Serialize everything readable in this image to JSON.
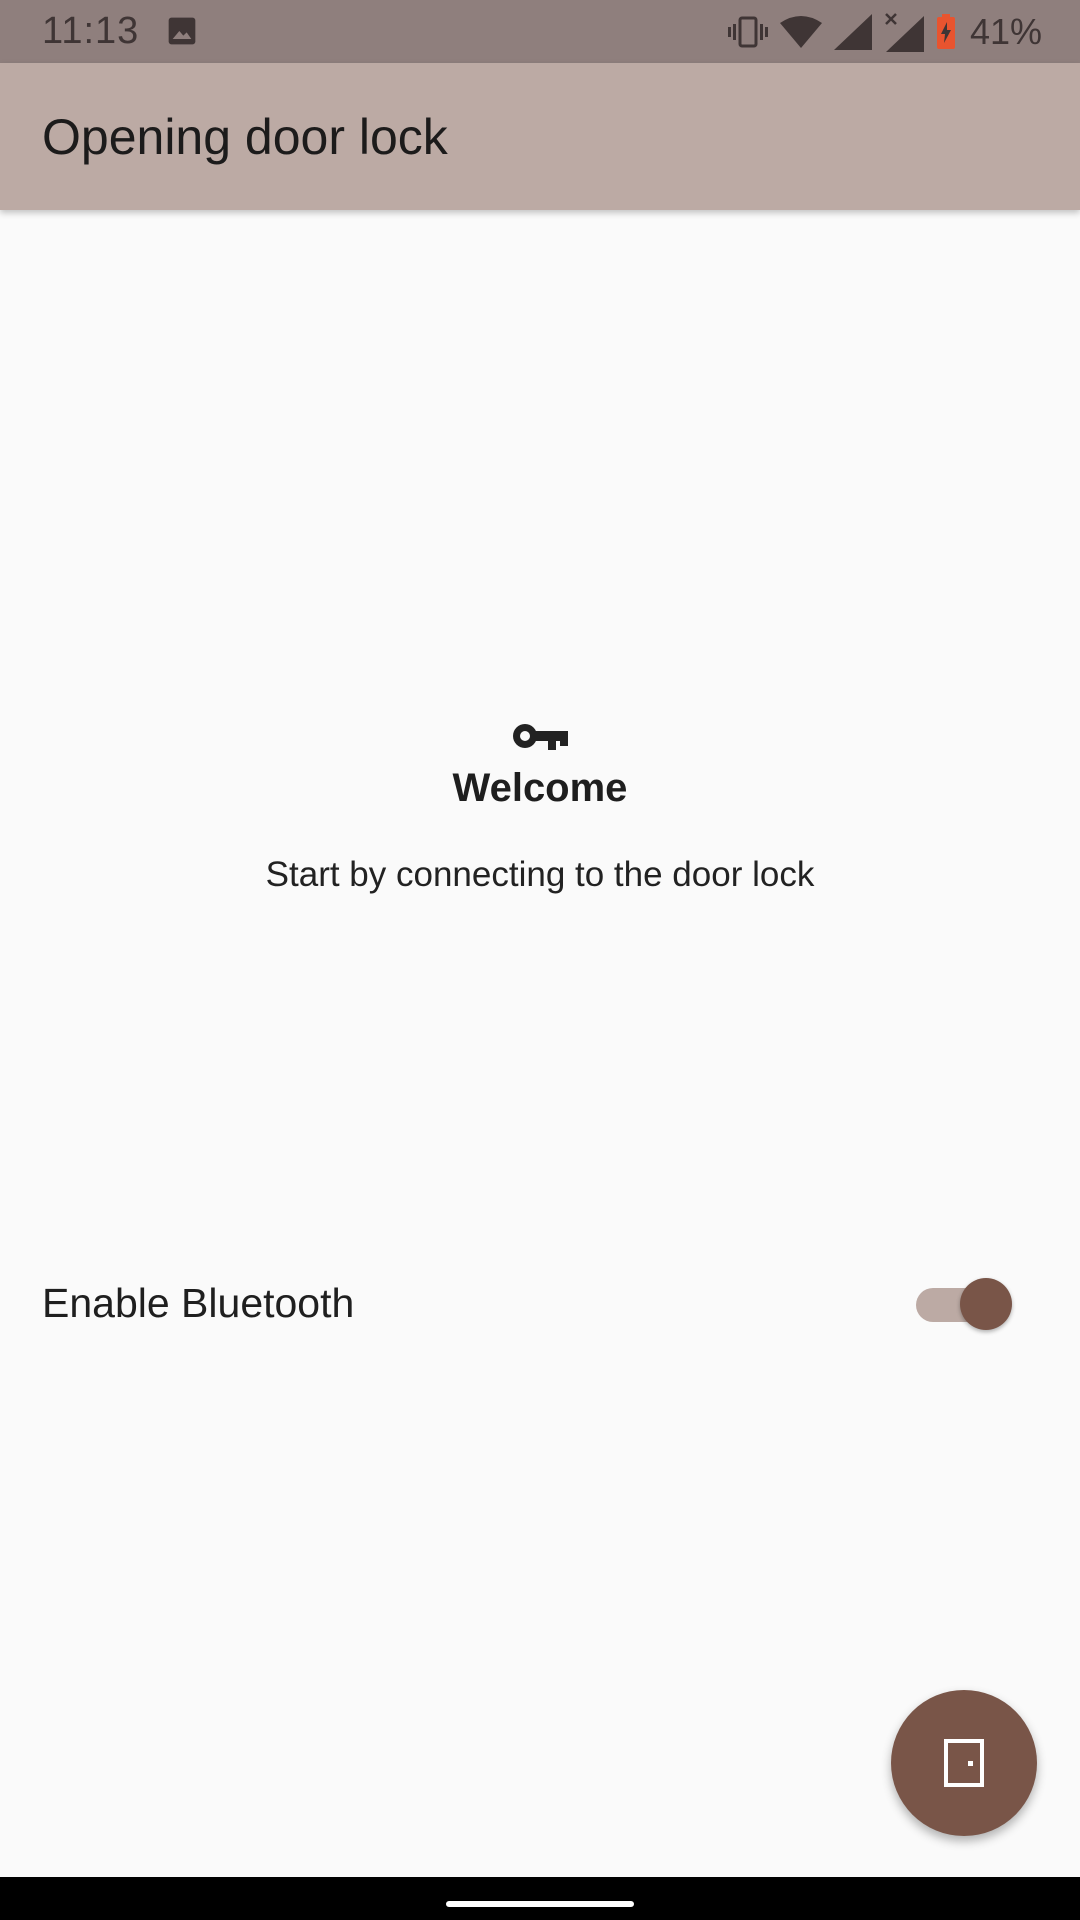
{
  "status_bar": {
    "time": "11:13",
    "battery_percent": "41%",
    "icons": [
      "image-icon",
      "vibrate-icon",
      "wifi-icon",
      "cell-signal-icon",
      "cell-signal-no-data-icon",
      "battery-charging-icon"
    ]
  },
  "app_bar": {
    "title": "Opening door lock"
  },
  "welcome": {
    "icon": "key-icon",
    "title": "Welcome",
    "subtitle": "Start by connecting to the door lock"
  },
  "bluetooth": {
    "label": "Enable Bluetooth",
    "enabled": true
  },
  "fab": {
    "icon": "door-icon"
  },
  "colors": {
    "status_bar": "#8f7f7d",
    "app_bar": "#bcaaa4",
    "accent": "#795548",
    "background": "#fafafa",
    "battery": "#e8542f"
  }
}
